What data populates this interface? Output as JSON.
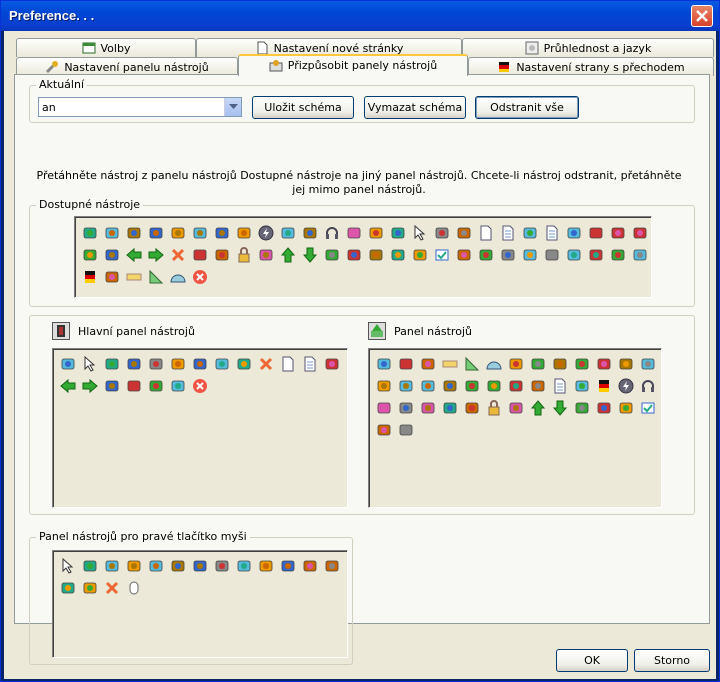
{
  "window": {
    "title": "Preference. . ."
  },
  "tabs_top": [
    {
      "label": "Volby",
      "icon": "settings-window-icon"
    },
    {
      "label": "Nastavení nové stránky",
      "icon": "blank-page-icon"
    },
    {
      "label": "Průhlednost a jazyk",
      "icon": "transparency-icon"
    }
  ],
  "tabs_bottom": [
    {
      "label": "Nastavení panelu nástrojů",
      "icon": "wrench-icon"
    },
    {
      "label": "Přizpůsobit panely nástrojů",
      "icon": "customize-toolbar-icon",
      "active": true
    },
    {
      "label": "Nastavení strany s přechodem",
      "icon": "gradient-icon"
    }
  ],
  "current": {
    "group_label": "Aktuální",
    "scheme_value": "an",
    "save_label": "Uložit schéma",
    "clear_label": "Vymazat schéma",
    "remove_all_label": "Odstranit vše"
  },
  "hint": "Přetáhněte nástroj z panelu nástrojů Dostupné nástroje na jiný panel nástrojů. Chcete-li nástroj odstranit, přetáhněte jej mimo panel nástrojů.",
  "available": {
    "label": "Dostupné nástroje",
    "icons": [
      "pencil",
      "brush",
      "spray",
      "line-tool",
      "text-spell",
      "dropper",
      "pen",
      "shapes",
      "flash",
      "stamp-abc",
      "clone",
      "headphones",
      "save-disk",
      "compass",
      "hand",
      "pointer",
      "eraser",
      "select-rect",
      "page",
      "pages",
      "frame-window",
      "page-lines",
      "mask",
      "shapes2",
      "canvas",
      "cut-paste",
      "wand",
      "grid-table",
      "arrow-left",
      "arrow-right",
      "delete-x",
      "floppy",
      "keyboard",
      "lock",
      "image",
      "arrow-up",
      "arrow-down",
      "screen",
      "network",
      "camera",
      "rotate",
      "loop",
      "check-window",
      "text-size",
      "image-stack",
      "cut-save",
      "paint-fill",
      "calendar",
      "patch",
      "link",
      "brush-fill",
      "bucket",
      "gradient",
      "stamp-person",
      "ruler",
      "triangle",
      "protractor",
      "cancel"
    ]
  },
  "main_toolbar": {
    "label": "Hlavní panel nástrojů",
    "icons": [
      "mask",
      "pointer",
      "pencil",
      "pen",
      "eraser",
      "shapes",
      "line-tool",
      "stamp-abc",
      "rotate",
      "delete-x",
      "page",
      "page-lines",
      "canvas",
      "arrow-left",
      "arrow-right",
      "grid-table",
      "floppy",
      "image-stack",
      "patch",
      "cancel"
    ]
  },
  "toolbar": {
    "label": "Panel nástrojů",
    "icons": [
      "mask",
      "shapes2",
      "stamp-person",
      "ruler",
      "triangle",
      "protractor",
      "compass",
      "screen",
      "camera",
      "image-stack",
      "cut-paste",
      "stamp",
      "bucket",
      "text-spell",
      "dropper",
      "brush",
      "spray",
      "brush-fill",
      "wand",
      "link",
      "select-rect",
      "pages",
      "frame-window",
      "gradient",
      "flash",
      "headphones",
      "save-disk",
      "cut-save",
      "image",
      "hand",
      "keyboard",
      "lock",
      "image",
      "arrow-up",
      "arrow-down",
      "screen",
      "network",
      "loop",
      "check-window",
      "text-size",
      "calendar"
    ]
  },
  "context_toolbar": {
    "label": "Panel nástrojů pro pravé tlačítko myši",
    "icons": [
      "pointer",
      "pencil",
      "dropper",
      "text-spell",
      "brush",
      "spray",
      "pen",
      "eraser",
      "stamp-abc",
      "shapes",
      "line-tool",
      "stamp-person",
      "select-rect",
      "rotate",
      "loop",
      "delete-x",
      "mouse"
    ]
  },
  "buttons": {
    "ok": "OK",
    "cancel": "Storno"
  }
}
